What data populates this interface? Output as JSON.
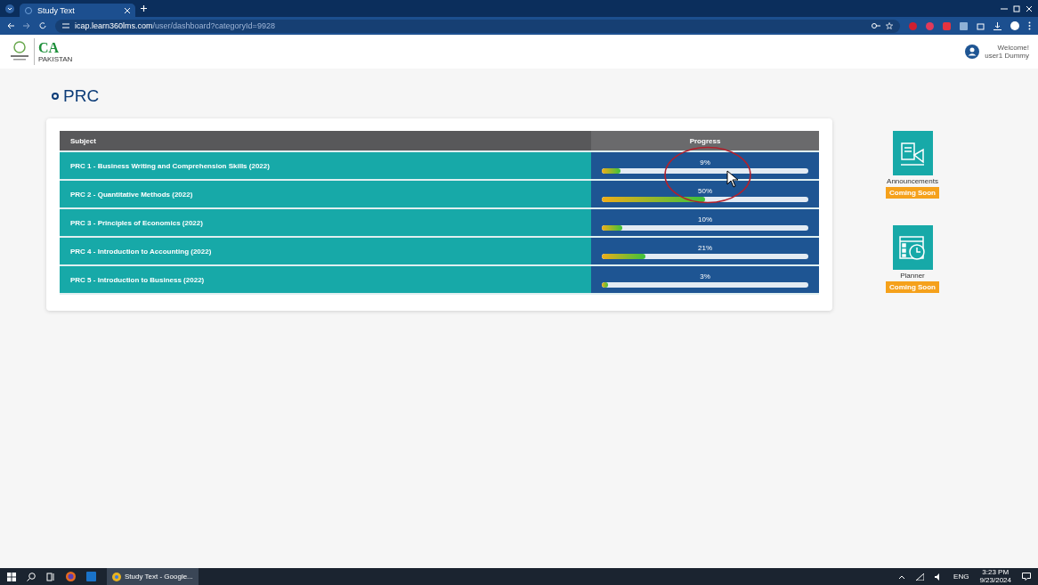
{
  "browser": {
    "tab_title": "Study Text",
    "url_host": "icap.learn360lms.com",
    "url_path": "/user/dashboard?categoryId=9928"
  },
  "header": {
    "logo_text": "CA",
    "logo_subtext": "PAKISTAN",
    "welcome": "Welcome!",
    "user": "user1 Dummy"
  },
  "page": {
    "title": "PRC"
  },
  "table": {
    "columns": [
      "Subject",
      "Progress"
    ],
    "rows": [
      {
        "subject": "PRC 1 - Business Writing and Comprehension Skills (2022)",
        "progress": "9%",
        "level": 0.09
      },
      {
        "subject": "PRC 2 - Quantitative Methods (2022)",
        "progress": "50%",
        "level": 0.5
      },
      {
        "subject": "PRC 3 - Principles of Economics (2022)",
        "progress": "10%",
        "level": 0.1
      },
      {
        "subject": "PRC 4 - Introduction to Accounting (2022)",
        "progress": "21%",
        "level": 0.21
      },
      {
        "subject": "PRC 5 - Introduction to Business (2022)",
        "progress": "3%",
        "level": 0.03
      }
    ]
  },
  "widgets": [
    {
      "kind": "announcements",
      "label": "Announcements",
      "badge": "Coming Soon"
    },
    {
      "kind": "planner",
      "label": "Planner",
      "badge": "Coming Soon"
    }
  ],
  "taskbar": {
    "app_label": "Study Text - Google...",
    "language": "ENG",
    "time": "3:23 PM",
    "date": "9/23/2024"
  }
}
